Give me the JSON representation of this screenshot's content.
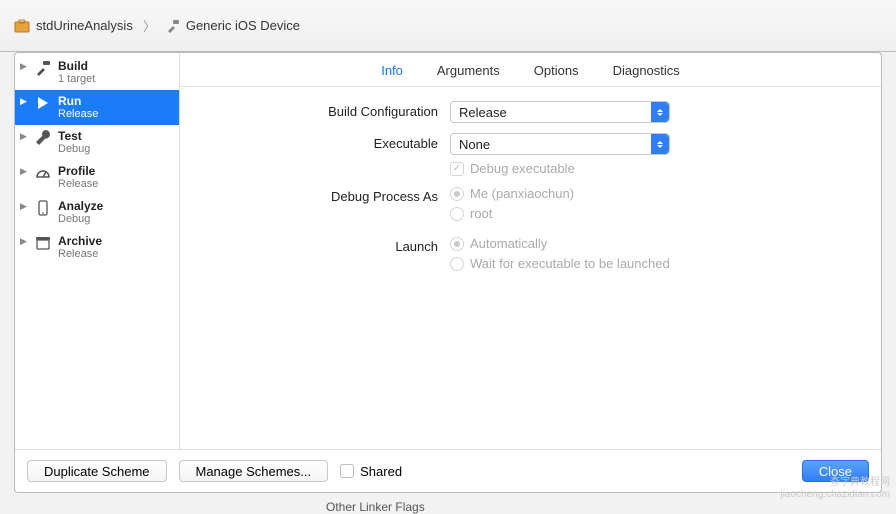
{
  "breadcrumb": {
    "project": "stdUrineAnalysis",
    "target": "Generic iOS Device"
  },
  "sidebar": {
    "items": [
      {
        "title": "Build",
        "sub": "1 target",
        "icon": "hammer",
        "selected": false
      },
      {
        "title": "Run",
        "sub": "Release",
        "icon": "play",
        "selected": true
      },
      {
        "title": "Test",
        "sub": "Debug",
        "icon": "wrench",
        "selected": false
      },
      {
        "title": "Profile",
        "sub": "Release",
        "icon": "gauge",
        "selected": false
      },
      {
        "title": "Analyze",
        "sub": "Debug",
        "icon": "device",
        "selected": false
      },
      {
        "title": "Archive",
        "sub": "Release",
        "icon": "box",
        "selected": false
      }
    ]
  },
  "tabs": {
    "items": [
      "Info",
      "Arguments",
      "Options",
      "Diagnostics"
    ],
    "active": "Info"
  },
  "form": {
    "build_configuration": {
      "label": "Build Configuration",
      "value": "Release"
    },
    "executable": {
      "label": "Executable",
      "value": "None"
    },
    "debug_executable": {
      "label": "Debug executable",
      "checked": true,
      "disabled": true
    },
    "debug_process_as": {
      "label": "Debug Process As",
      "options": [
        {
          "label": "Me (panxiaochun)",
          "selected": true
        },
        {
          "label": "root",
          "selected": false
        }
      ],
      "disabled": true
    },
    "launch": {
      "label": "Launch",
      "options": [
        {
          "label": "Automatically",
          "selected": true
        },
        {
          "label": "Wait for executable to be launched",
          "selected": false
        }
      ],
      "disabled": true
    }
  },
  "footer": {
    "duplicate": "Duplicate Scheme",
    "manage": "Manage Schemes...",
    "shared": {
      "label": "Shared",
      "checked": false
    },
    "close": "Close"
  },
  "background_hint": "Other Linker Flags",
  "watermark": {
    "line1": "查字典教程网",
    "line2": "jiaocheng.chazidian.com"
  }
}
